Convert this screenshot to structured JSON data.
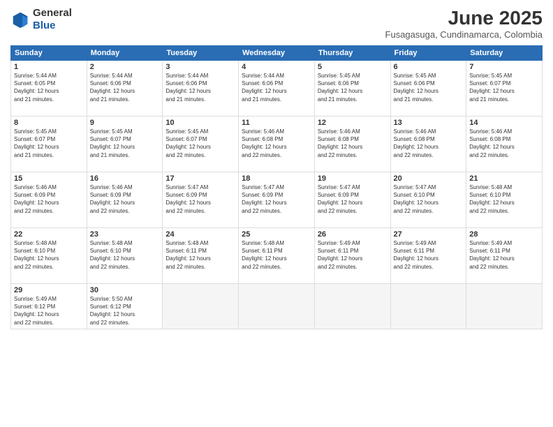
{
  "logo": {
    "line1": "General",
    "line2": "Blue"
  },
  "title": "June 2025",
  "location": "Fusagasuga, Cundinamarca, Colombia",
  "headers": [
    "Sunday",
    "Monday",
    "Tuesday",
    "Wednesday",
    "Thursday",
    "Friday",
    "Saturday"
  ],
  "weeks": [
    [
      {
        "day": "1",
        "info": "Sunrise: 5:44 AM\nSunset: 6:05 PM\nDaylight: 12 hours\nand 21 minutes."
      },
      {
        "day": "2",
        "info": "Sunrise: 5:44 AM\nSunset: 6:06 PM\nDaylight: 12 hours\nand 21 minutes."
      },
      {
        "day": "3",
        "info": "Sunrise: 5:44 AM\nSunset: 6:06 PM\nDaylight: 12 hours\nand 21 minutes."
      },
      {
        "day": "4",
        "info": "Sunrise: 5:44 AM\nSunset: 6:06 PM\nDaylight: 12 hours\nand 21 minutes."
      },
      {
        "day": "5",
        "info": "Sunrise: 5:45 AM\nSunset: 6:06 PM\nDaylight: 12 hours\nand 21 minutes."
      },
      {
        "day": "6",
        "info": "Sunrise: 5:45 AM\nSunset: 6:06 PM\nDaylight: 12 hours\nand 21 minutes."
      },
      {
        "day": "7",
        "info": "Sunrise: 5:45 AM\nSunset: 6:07 PM\nDaylight: 12 hours\nand 21 minutes."
      }
    ],
    [
      {
        "day": "8",
        "info": "Sunrise: 5:45 AM\nSunset: 6:07 PM\nDaylight: 12 hours\nand 21 minutes."
      },
      {
        "day": "9",
        "info": "Sunrise: 5:45 AM\nSunset: 6:07 PM\nDaylight: 12 hours\nand 21 minutes."
      },
      {
        "day": "10",
        "info": "Sunrise: 5:45 AM\nSunset: 6:07 PM\nDaylight: 12 hours\nand 22 minutes."
      },
      {
        "day": "11",
        "info": "Sunrise: 5:46 AM\nSunset: 6:08 PM\nDaylight: 12 hours\nand 22 minutes."
      },
      {
        "day": "12",
        "info": "Sunrise: 5:46 AM\nSunset: 6:08 PM\nDaylight: 12 hours\nand 22 minutes."
      },
      {
        "day": "13",
        "info": "Sunrise: 5:46 AM\nSunset: 6:08 PM\nDaylight: 12 hours\nand 22 minutes."
      },
      {
        "day": "14",
        "info": "Sunrise: 5:46 AM\nSunset: 6:08 PM\nDaylight: 12 hours\nand 22 minutes."
      }
    ],
    [
      {
        "day": "15",
        "info": "Sunrise: 5:46 AM\nSunset: 6:09 PM\nDaylight: 12 hours\nand 22 minutes."
      },
      {
        "day": "16",
        "info": "Sunrise: 5:46 AM\nSunset: 6:09 PM\nDaylight: 12 hours\nand 22 minutes."
      },
      {
        "day": "17",
        "info": "Sunrise: 5:47 AM\nSunset: 6:09 PM\nDaylight: 12 hours\nand 22 minutes."
      },
      {
        "day": "18",
        "info": "Sunrise: 5:47 AM\nSunset: 6:09 PM\nDaylight: 12 hours\nand 22 minutes."
      },
      {
        "day": "19",
        "info": "Sunrise: 5:47 AM\nSunset: 6:09 PM\nDaylight: 12 hours\nand 22 minutes."
      },
      {
        "day": "20",
        "info": "Sunrise: 5:47 AM\nSunset: 6:10 PM\nDaylight: 12 hours\nand 22 minutes."
      },
      {
        "day": "21",
        "info": "Sunrise: 5:48 AM\nSunset: 6:10 PM\nDaylight: 12 hours\nand 22 minutes."
      }
    ],
    [
      {
        "day": "22",
        "info": "Sunrise: 5:48 AM\nSunset: 6:10 PM\nDaylight: 12 hours\nand 22 minutes."
      },
      {
        "day": "23",
        "info": "Sunrise: 5:48 AM\nSunset: 6:10 PM\nDaylight: 12 hours\nand 22 minutes."
      },
      {
        "day": "24",
        "info": "Sunrise: 5:48 AM\nSunset: 6:11 PM\nDaylight: 12 hours\nand 22 minutes."
      },
      {
        "day": "25",
        "info": "Sunrise: 5:48 AM\nSunset: 6:11 PM\nDaylight: 12 hours\nand 22 minutes."
      },
      {
        "day": "26",
        "info": "Sunrise: 5:49 AM\nSunset: 6:11 PM\nDaylight: 12 hours\nand 22 minutes."
      },
      {
        "day": "27",
        "info": "Sunrise: 5:49 AM\nSunset: 6:11 PM\nDaylight: 12 hours\nand 22 minutes."
      },
      {
        "day": "28",
        "info": "Sunrise: 5:49 AM\nSunset: 6:11 PM\nDaylight: 12 hours\nand 22 minutes."
      }
    ],
    [
      {
        "day": "29",
        "info": "Sunrise: 5:49 AM\nSunset: 6:12 PM\nDaylight: 12 hours\nand 22 minutes."
      },
      {
        "day": "30",
        "info": "Sunrise: 5:50 AM\nSunset: 6:12 PM\nDaylight: 12 hours\nand 22 minutes."
      },
      {
        "day": "",
        "info": ""
      },
      {
        "day": "",
        "info": ""
      },
      {
        "day": "",
        "info": ""
      },
      {
        "day": "",
        "info": ""
      },
      {
        "day": "",
        "info": ""
      }
    ]
  ]
}
